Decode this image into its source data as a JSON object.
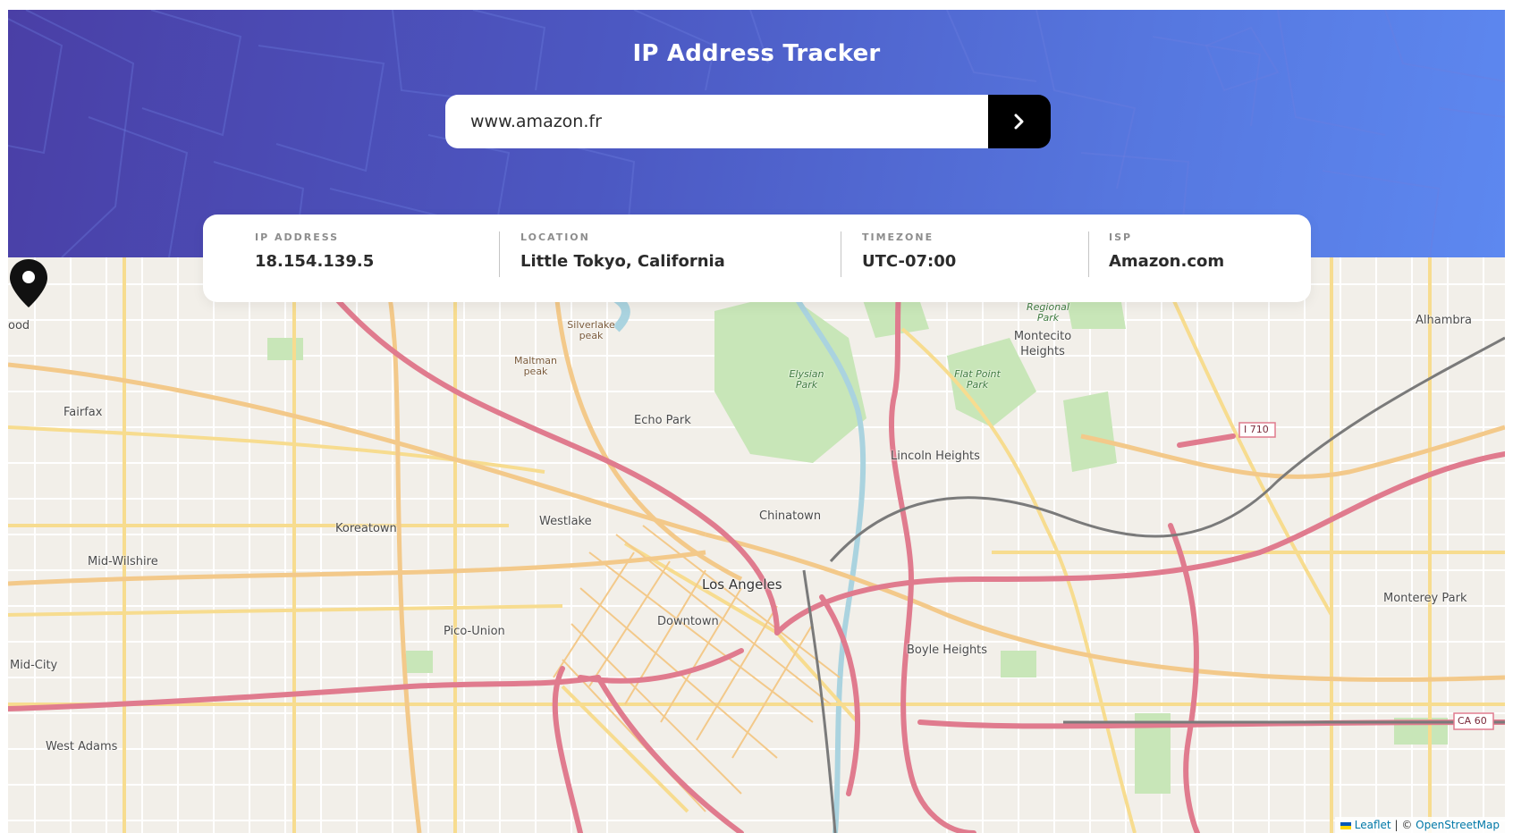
{
  "header": {
    "title": "IP Address Tracker"
  },
  "search": {
    "value": "www.amazon.fr",
    "button_icon": "chevron-right-icon"
  },
  "info": {
    "ip_label": "IP ADDRESS",
    "ip_value": "18.154.139.5",
    "location_label": "LOCATION",
    "location_value": "Little Tokyo, California",
    "timezone_label": "TIMEZONE",
    "timezone_value": "UTC-07:00",
    "isp_label": "ISP",
    "isp_value": "Amazon.com"
  },
  "map": {
    "labels": {
      "hollywood": "ood",
      "fairfax": "Fairfax",
      "mid_wilshire": "Mid-Wilshire",
      "koreatown": "Koreatown",
      "mid_city": "Mid-City",
      "west_adams": "West Adams",
      "pico_union": "Pico-Union",
      "westlake": "Westlake",
      "echo_park": "Echo Park",
      "chinatown": "Chinatown",
      "los_angeles": "Los Angeles",
      "downtown": "Downtown",
      "lincoln_heights": "Lincoln Heights",
      "boyle_heights": "Boyle Heights",
      "montecito_heights": "Montecito Heights",
      "alhambra": "Alhambra",
      "monterey_park": "Monterey Park",
      "silverlake_peak": "Silverlake peak",
      "maltman_peak": "Maltman peak",
      "elysian_park": "Elysian Park",
      "flat_point_park": "Flat Point Park",
      "debs_park": "E. Debs Regional Park",
      "i710": "I 710",
      "ca60": "CA 60"
    },
    "marker_icon": "location-pin-icon",
    "attribution": {
      "leaflet": "Leaflet",
      "separator": "| ©",
      "osm": "OpenStreetMap"
    }
  },
  "colors": {
    "header_start": "#4a3fa6",
    "header_end": "#5d88f0",
    "button": "#000000",
    "highway": "#e07b8e",
    "primary_road": "#f3c98a",
    "park": "#c8e6b8",
    "water": "#aad3df"
  }
}
